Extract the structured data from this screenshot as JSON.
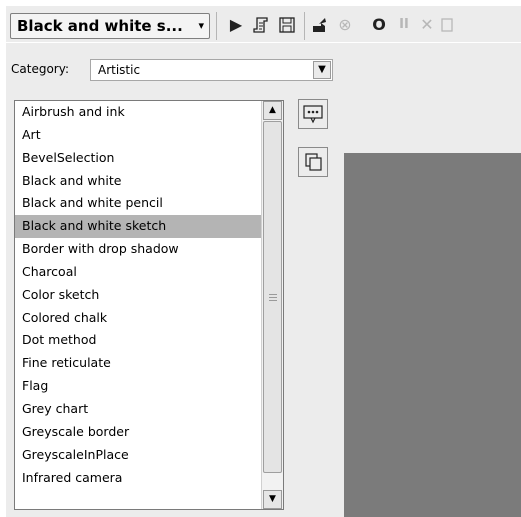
{
  "toolbar": {
    "preset_label": "Black and white s...",
    "buttons": [
      {
        "name": "play-icon",
        "glyph": "▶"
      },
      {
        "name": "script-icon"
      },
      {
        "name": "save-icon"
      },
      {
        "name": "export-icon"
      },
      {
        "name": "cancel-icon",
        "glyph": "⊗",
        "disabled": true
      },
      {
        "name": "record-icon",
        "glyph": "O"
      },
      {
        "name": "pause-icon",
        "glyph": "II",
        "disabled": true
      },
      {
        "name": "close-icon",
        "glyph": "✕",
        "disabled": true
      }
    ]
  },
  "category": {
    "label": "Category:",
    "value": "Artistic"
  },
  "list": {
    "items": [
      "Airbrush and ink",
      "Art",
      "BevelSelection",
      "Black and white",
      "Black and white pencil",
      "Black and white sketch",
      "Border with drop shadow",
      "Charcoal",
      "Color sketch",
      "Colored chalk",
      "Dot method",
      "Fine reticulate",
      "Flag",
      "Grey chart",
      "Greyscale border",
      "GreyscaleInPlace",
      "Infrared camera"
    ],
    "selected_index": 5
  },
  "colors": {
    "panel_bg": "#ececec",
    "canvas_bg": "#7b7b7b",
    "selection_bg": "#b4b4b4"
  }
}
